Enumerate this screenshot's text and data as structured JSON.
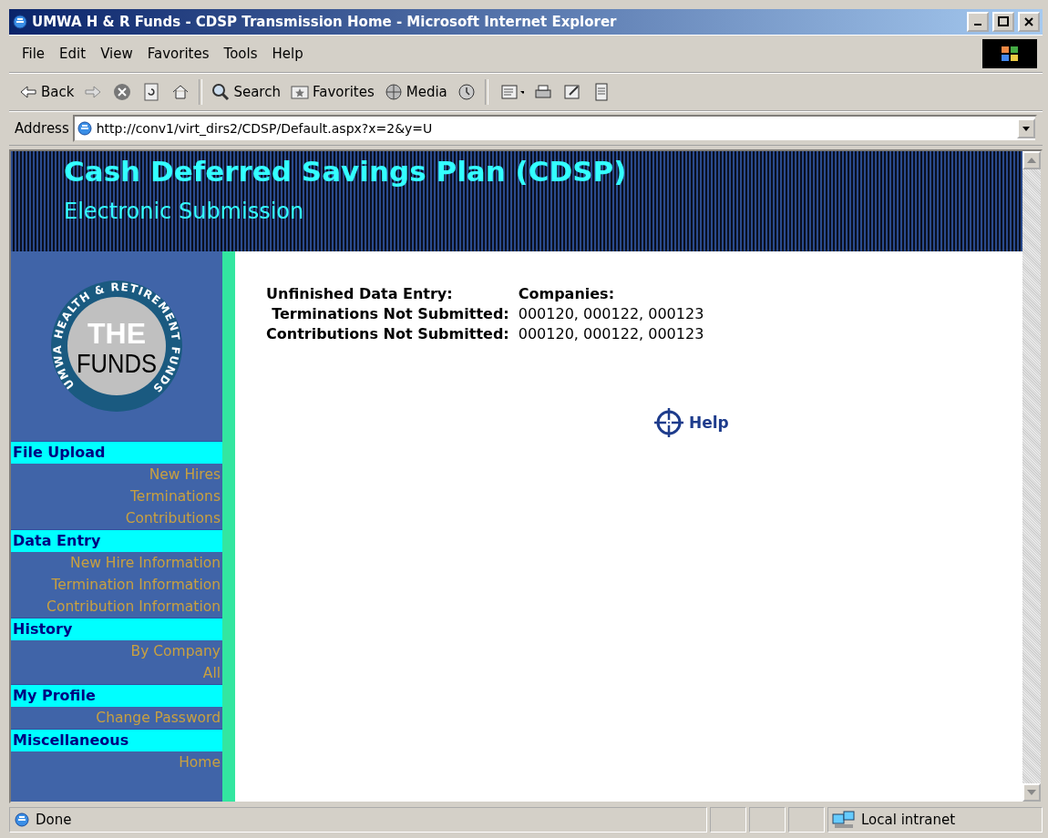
{
  "window": {
    "title": "UMWA H & R Funds - CDSP Transmission Home - Microsoft Internet Explorer"
  },
  "menu": [
    "File",
    "Edit",
    "View",
    "Favorites",
    "Tools",
    "Help"
  ],
  "toolbar": [
    {
      "kind": "back",
      "label": "Back"
    },
    {
      "kind": "forward"
    },
    {
      "kind": "stop"
    },
    {
      "kind": "refresh"
    },
    {
      "kind": "home"
    },
    {
      "kind": "search",
      "label": "Search"
    },
    {
      "kind": "favorites",
      "label": "Favorites"
    },
    {
      "kind": "media",
      "label": "Media"
    },
    {
      "kind": "history"
    },
    {
      "kind": "mail"
    },
    {
      "kind": "print"
    },
    {
      "kind": "edit"
    },
    {
      "kind": "discuss"
    }
  ],
  "address": {
    "label": "Address",
    "value": "http://conv1/virt_dirs2/CDSP/Default.aspx?x=2&y=U"
  },
  "header": {
    "title": "Cash Deferred Savings Plan (CDSP)",
    "subtitle": "Electronic Submission"
  },
  "logo": {
    "ring_text": "UMWA HEALTH & RETIREMENT FUNDS",
    "top": "THE",
    "bottom": "FUNDS"
  },
  "sidebar": [
    {
      "heading": "File Upload",
      "items": [
        "New Hires",
        "Terminations",
        "Contributions"
      ]
    },
    {
      "heading": "Data Entry",
      "items": [
        "New Hire Information",
        "Termination Information",
        "Contribution Information"
      ]
    },
    {
      "heading": "History",
      "items": [
        "By Company",
        "All"
      ]
    },
    {
      "heading": "My Profile",
      "items": [
        "Change Password"
      ]
    },
    {
      "heading": "Miscellaneous",
      "items": [
        "Home"
      ]
    }
  ],
  "summary": {
    "heading": "Unfinished Data Entry:",
    "column_heading": "Companies:",
    "rows": [
      {
        "label": "Terminations Not Submitted:",
        "value": "000120, 000122, 000123"
      },
      {
        "label": "Contributions Not Submitted:",
        "value": "000120, 000122, 000123"
      }
    ]
  },
  "help": {
    "label": "Help"
  },
  "status_bar": {
    "text": "Done",
    "zone": "Local intranet"
  }
}
